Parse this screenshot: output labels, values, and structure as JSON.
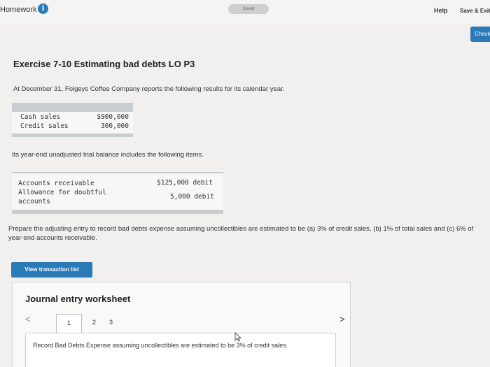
{
  "topbar": {
    "title": "Homework",
    "info_glyph": "i",
    "saved_label": "Saved",
    "help_label": "Help",
    "save_exit_label": "Save & Exit",
    "check_label": "Check"
  },
  "exercise": {
    "title": "Exercise 7-10 Estimating bad debts LO P3",
    "intro": "At December 31, Folgeys Coffee Company reports the following results for its calendar year.",
    "sales_table": [
      {
        "label": "Cash sales",
        "value": "$900,000"
      },
      {
        "label": "Credit sales",
        "value": "300,000"
      }
    ],
    "intro2": "Its year-end unadjusted trial balance includes the following items.",
    "trial_balance": {
      "row1_label": "Accounts receivable",
      "row1_value": "$125,000 debit",
      "row2_label_line1": "Allowance for doubtful",
      "row2_label_line2": "accounts",
      "row2_value": "5,000 debit"
    },
    "prompt": "Prepare the adjusting entry to record bad debts expense assuming uncollectibles are estimated to be (a) 3% of credit sales, (b) 1% of total sales and (c) 6% of year-end accounts receivable."
  },
  "view_transaction_label": "View transaction list",
  "worksheet": {
    "title": "Journal entry worksheet",
    "prev_glyph": "<",
    "next_glyph": ">",
    "pages": [
      "1",
      "2",
      "3"
    ],
    "instruction": "Record Bad Debts Expense assuming uncollectibles are estimated to be 3% of credit sales."
  },
  "colors": {
    "accent": "#2a7ab8",
    "table_band": "#c9cdd3"
  },
  "icons": {
    "info": "info-icon",
    "prev": "chevron-left-icon",
    "next": "chevron-right-icon",
    "cursor": "mouse-cursor-icon"
  }
}
